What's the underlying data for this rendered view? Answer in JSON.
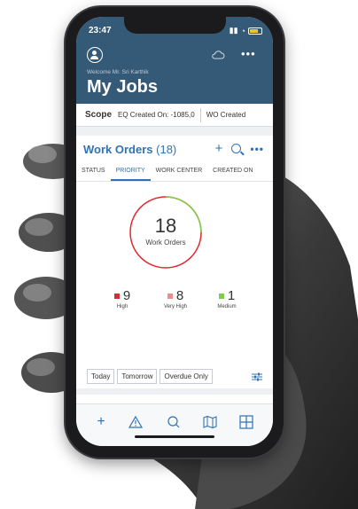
{
  "status_bar": {
    "time": "23:47"
  },
  "header": {
    "welcome": "Welcome Mr. Sri Karthik",
    "title": "My Jobs",
    "icons": [
      "user-icon",
      "cloud-icon",
      "more-icon"
    ]
  },
  "scope": {
    "label": "Scope",
    "items": [
      "EQ Created On: -1085,0",
      "WO Created"
    ]
  },
  "work_orders": {
    "title": "Work Orders",
    "count": "(18)",
    "tabs": [
      "STATUS",
      "PRIORITY",
      "WORK CENTER",
      "CREATED ON"
    ],
    "active_tab": "PRIORITY",
    "total": "18",
    "total_label": "Work Orders",
    "priorities": [
      {
        "value": "9",
        "label": "High",
        "color": "#e0282f"
      },
      {
        "value": "8",
        "label": "Very High",
        "color": "#f08a8c"
      },
      {
        "value": "1",
        "label": "Medium",
        "color": "#7ccf4a"
      }
    ],
    "filters": [
      "Today",
      "Tomorrow",
      "Overdue Only"
    ]
  },
  "bottom_bar": {
    "icons": [
      "add-icon",
      "warning-icon",
      "search-icon",
      "map-icon",
      "grid-icon"
    ]
  },
  "colors": {
    "header": "#355a77",
    "accent": "#2f72b8"
  }
}
